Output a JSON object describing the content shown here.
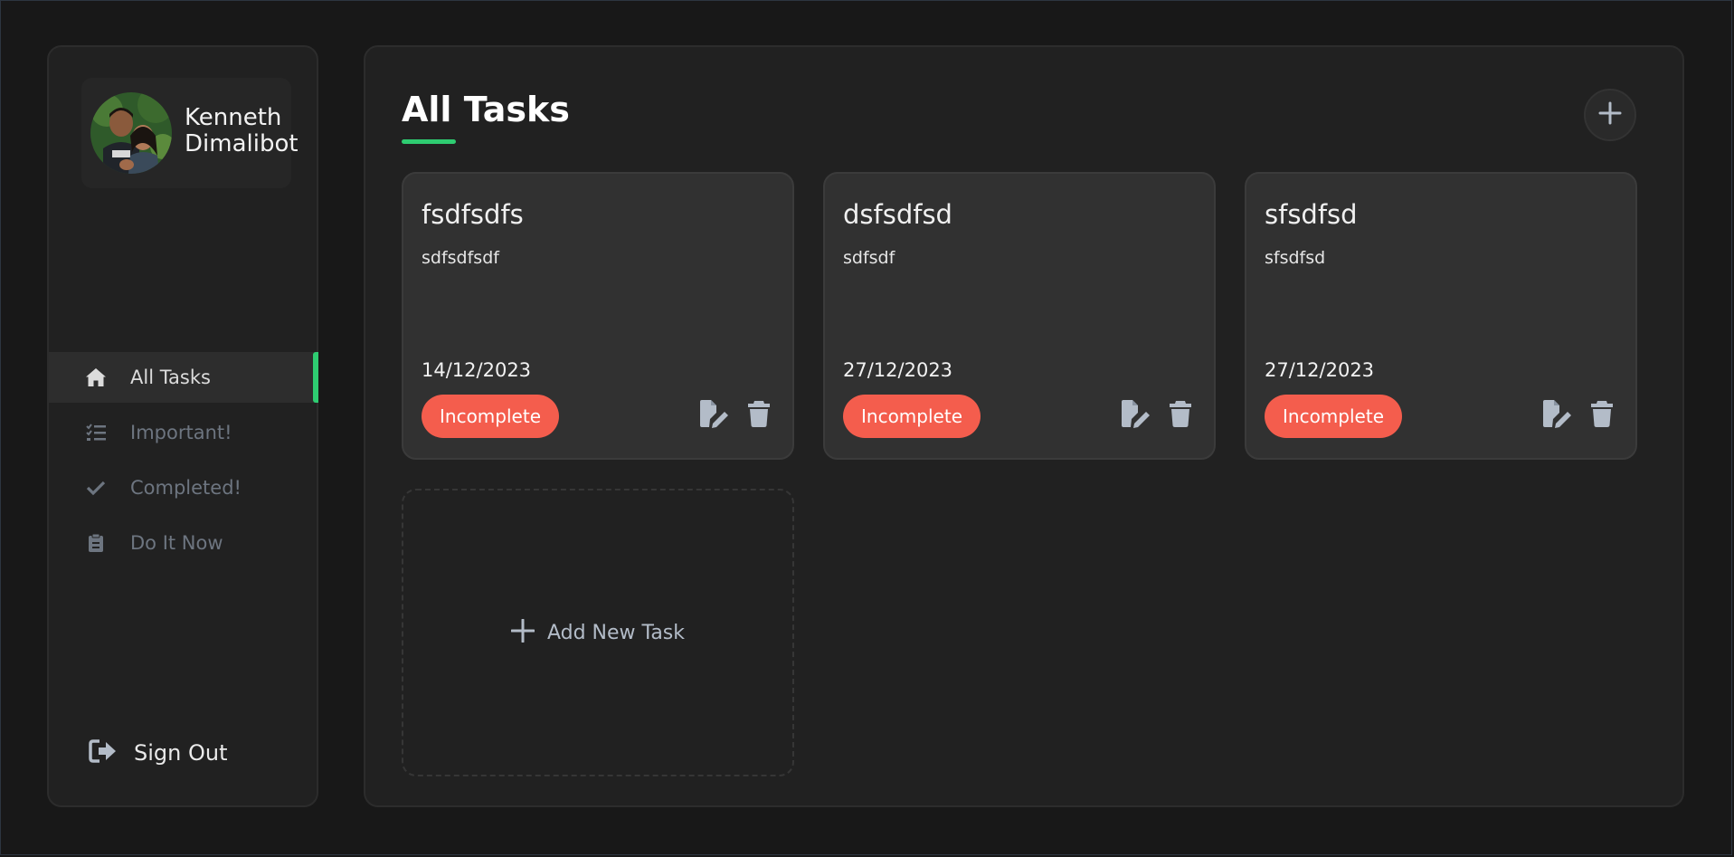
{
  "user": {
    "name_line1": "Kenneth",
    "name_line2": "Dimalibot"
  },
  "nav": [
    {
      "label": "All Tasks",
      "icon": "home-icon",
      "active": true
    },
    {
      "label": "Important!",
      "icon": "list-check-icon",
      "active": false
    },
    {
      "label": "Completed!",
      "icon": "check-icon",
      "active": false
    },
    {
      "label": "Do It Now",
      "icon": "clipboard-icon",
      "active": false
    }
  ],
  "signout": {
    "label": "Sign Out",
    "icon": "sign-out-icon"
  },
  "main": {
    "title": "All Tasks",
    "add_task_label": "Add New Task"
  },
  "tasks": [
    {
      "title": "fsdfsdfs",
      "description": "sdfsdfsdf",
      "date": "14/12/2023",
      "status": "Incomplete"
    },
    {
      "title": "dsfsdfsd",
      "description": "sdfsdf",
      "date": "27/12/2023",
      "status": "Incomplete"
    },
    {
      "title": "sfsdfsd",
      "description": "sfsdfsd",
      "date": "27/12/2023",
      "status": "Incomplete"
    }
  ],
  "colors": {
    "accent": "#2ecc71",
    "incomplete": "#f45d4d",
    "background": "#181818",
    "panel": "#212121",
    "card": "#313131"
  }
}
